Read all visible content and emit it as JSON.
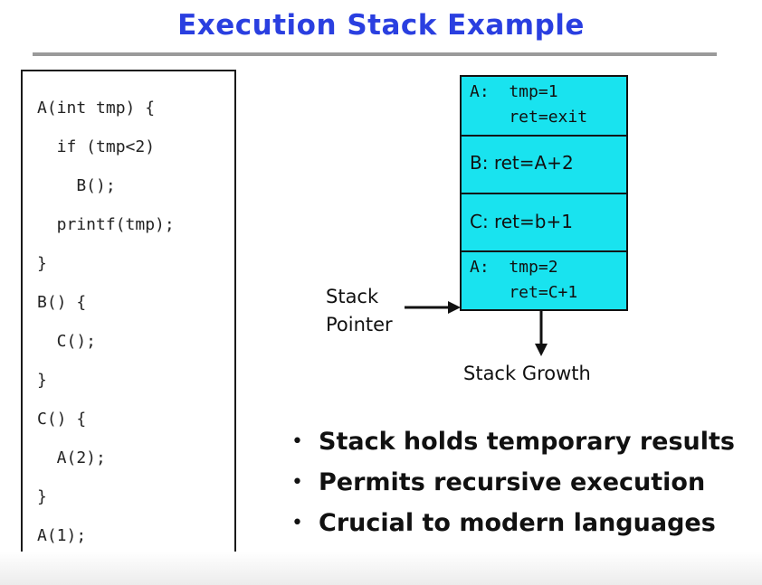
{
  "title": "Execution Stack Example",
  "code_lines": [
    "A(int tmp) {",
    "  if (tmp<2)",
    "    B();",
    "  printf(tmp);",
    "}",
    "B() {",
    "  C();",
    "}",
    "C() {",
    "  A(2);",
    "}",
    "A(1);"
  ],
  "stack": {
    "frames": [
      {
        "line1": "A:  tmp=1",
        "line2": "    ret=exit"
      },
      {
        "line1": "B: ret=A+2"
      },
      {
        "line1": "C: ret=b+1"
      },
      {
        "line1": "A:  tmp=2",
        "line2": "    ret=C+1"
      }
    ],
    "fill_color": "#19e3ef",
    "pointer_label_1": "Stack",
    "pointer_label_2": "Pointer",
    "growth_label": "Stack Growth"
  },
  "bullets": [
    "Stack holds temporary results",
    "Permits recursive execution",
    "Crucial to modern languages"
  ],
  "colors": {
    "title": "#2a3fe0",
    "stack_fill": "#19e3ef"
  }
}
